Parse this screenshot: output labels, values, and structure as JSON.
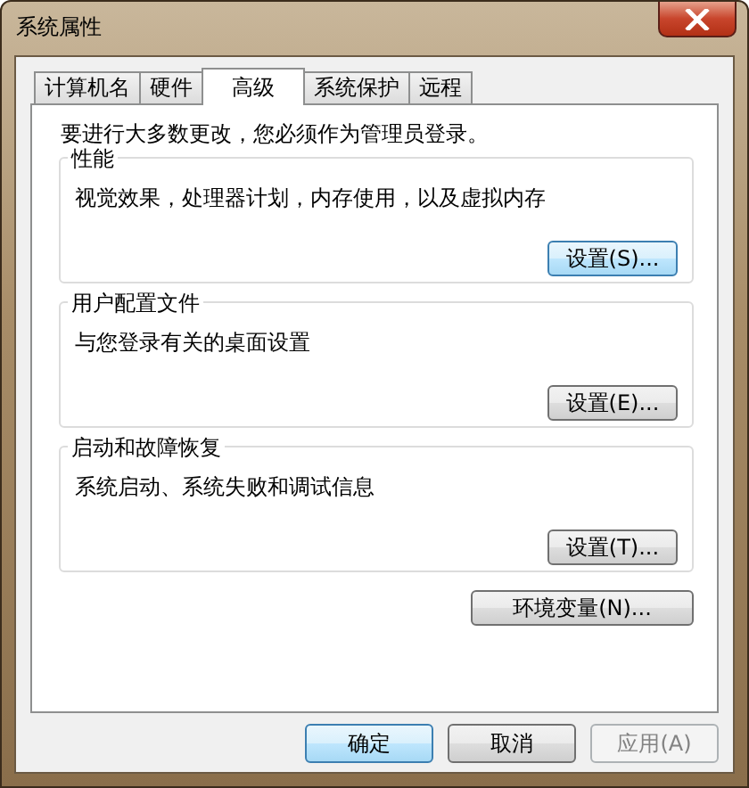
{
  "window": {
    "title": "系统属性"
  },
  "tabs": [
    {
      "label": "计算机名",
      "selected": false
    },
    {
      "label": "硬件",
      "selected": false
    },
    {
      "label": "高级",
      "selected": true
    },
    {
      "label": "系统保护",
      "selected": false
    },
    {
      "label": "远程",
      "selected": false
    }
  ],
  "notice": "要进行大多数更改，您必须作为管理员登录。",
  "groups": [
    {
      "title": "性能",
      "description": "视觉效果，处理器计划，内存使用，以及虚拟内存",
      "button": {
        "label": "设置(S)...",
        "default": true
      }
    },
    {
      "title": "用户配置文件",
      "description": "与您登录有关的桌面设置",
      "button": {
        "label": "设置(E)...",
        "default": false
      }
    },
    {
      "title": "启动和故障恢复",
      "description": "系统启动、系统失败和调试信息",
      "button": {
        "label": "设置(T)...",
        "default": false
      }
    }
  ],
  "env_button": {
    "label": "环境变量(N)..."
  },
  "buttons": [
    {
      "label": "确定",
      "default": true,
      "disabled": false
    },
    {
      "label": "取消",
      "default": false,
      "disabled": false
    },
    {
      "label": "应用(A)",
      "default": false,
      "disabled": true
    }
  ]
}
